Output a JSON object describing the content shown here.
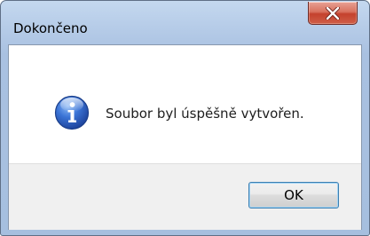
{
  "window": {
    "title": "Dokončeno"
  },
  "message": {
    "text": "Soubor byl úspěšně vytvořen.",
    "icon": "info-icon"
  },
  "buttons": {
    "ok_label": "OK"
  },
  "colors": {
    "accent": "#3c7fb1",
    "close_button": "#c4412d",
    "info_icon": "#2a63c4"
  }
}
